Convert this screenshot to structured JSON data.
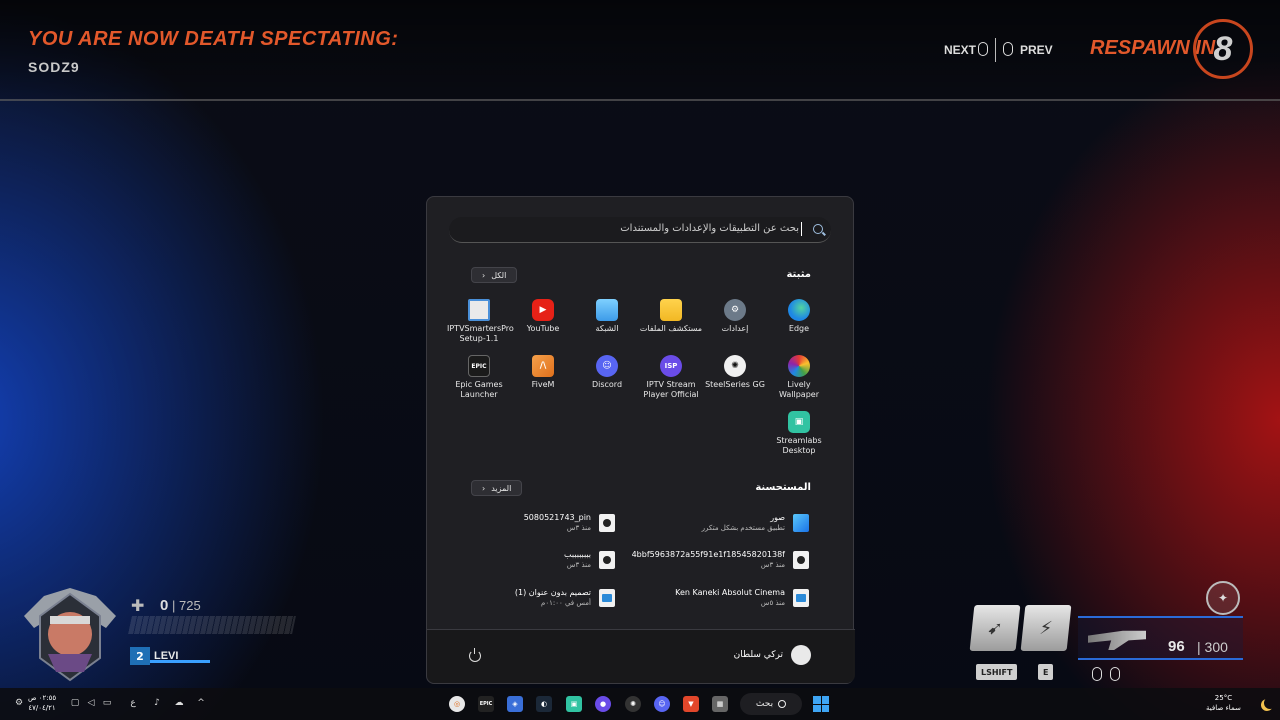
{
  "hud_top": {
    "spectating_label": "YOU ARE NOW DEATH SPECTATING:",
    "spectated_player": "SODZ9",
    "next_label": "NEXT",
    "prev_label": "PREV",
    "respawn_label": "RESPAWN IN",
    "respawn_seconds": "8"
  },
  "start_menu": {
    "search_placeholder": "بحث عن التطبيقات والإعدادات والمستندات",
    "pinned_title": "مثبتة",
    "all_button": "الكل",
    "pinned_apps": [
      {
        "label": "Edge",
        "icon": "edge-icon",
        "color": "#1e88e5"
      },
      {
        "label": "إعدادات",
        "icon": "gear-icon",
        "color": "#6c7a89"
      },
      {
        "label": "مستكشف الملفات",
        "icon": "folder-icon",
        "color": "#f2b824"
      },
      {
        "label": "الشبكة",
        "icon": "network-icon",
        "color": "#3d9be9"
      },
      {
        "label": "YouTube",
        "icon": "youtube-icon",
        "color": "#e62117"
      },
      {
        "label": "IPTVSmartersPro Setup-1.1",
        "icon": "installer-icon",
        "color": "#4a90d9"
      },
      {
        "label": "Lively Wallpaper",
        "icon": "lively-icon",
        "color": "#e53935"
      },
      {
        "label": "SteelSeries GG",
        "icon": "steelseries-icon",
        "color": "#f0f0f0"
      },
      {
        "label": "IPTV Stream Player Official",
        "icon": "isp-icon",
        "color": "#6a4ce8"
      },
      {
        "label": "Discord",
        "icon": "discord-icon",
        "color": "#5865f2"
      },
      {
        "label": "FiveM",
        "icon": "fivem-icon",
        "color": "#f08a2e"
      },
      {
        "label": "Epic Games Launcher",
        "icon": "epic-icon",
        "color": "#1b1b1b"
      },
      {
        "label": "Streamlabs Desktop",
        "icon": "streamlabs-icon",
        "color": "#31c3a2"
      }
    ],
    "recommended_title": "المستحسنة",
    "more_button": "المزيد",
    "recommended": [
      {
        "title": "صور",
        "subtitle": "تطبيق مستخدم بشكل متكرر",
        "icon": "photos-icon"
      },
      {
        "title": "5080521743_pin",
        "subtitle": "منذ ٣س",
        "icon": "video-file-icon"
      },
      {
        "title": "4bbf5963872a55f91e1f18545820138f",
        "subtitle": "منذ ٣س",
        "icon": "video-file-icon"
      },
      {
        "title": "ببببببببب",
        "subtitle": "منذ ٣س",
        "icon": "video-file-icon"
      },
      {
        "title": "Ken Kaneki Absolut Cinema",
        "subtitle": "منذ ٥س",
        "icon": "image-file-icon"
      },
      {
        "title": "تصميم بدون عنوان (1)",
        "subtitle": "أمس في ٠١:٠٠م",
        "icon": "image-file-icon"
      }
    ],
    "user_name": "تركي سلطان"
  },
  "hud_player": {
    "hp_current": "0",
    "hp_max": "725",
    "level": "2",
    "player_name": "LEVI"
  },
  "hud_weapon": {
    "ability_keys": [
      "LSHIFT",
      "E"
    ],
    "ammo_current": "96",
    "ammo_max": "300"
  },
  "taskbar": {
    "time": "٠٢:٥٥ ص",
    "date": "٤٧/٠٤/٢١",
    "lang": "ع",
    "search_label": "بحث",
    "temperature": "25°C",
    "weather_text": "سماء صافية",
    "apps": [
      {
        "icon": "overwatch-icon",
        "color": "#f0f0f0"
      },
      {
        "icon": "epic-icon",
        "color": "#222"
      },
      {
        "icon": "app-icon",
        "color": "#3a6fd8"
      },
      {
        "icon": "steam-icon",
        "color": "#1b2838"
      },
      {
        "icon": "streamlabs-icon",
        "color": "#31c3a2"
      },
      {
        "icon": "isp-icon",
        "color": "#6a4ce8"
      },
      {
        "icon": "steelseries-icon",
        "color": "#333"
      },
      {
        "icon": "discord-icon",
        "color": "#5865f2"
      },
      {
        "icon": "brave-icon",
        "color": "#e2472b"
      },
      {
        "icon": "file-explorer-icon",
        "color": "#666"
      }
    ]
  }
}
